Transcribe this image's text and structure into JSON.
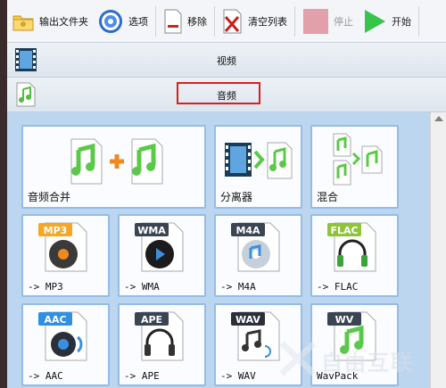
{
  "toolbar": {
    "output_folder_label": "输出文件夹",
    "options_label": "选项",
    "remove_label": "移除",
    "clear_list_label": "清空列表",
    "stop_label": "停止",
    "start_label": "开始"
  },
  "sections": {
    "video_label": "视频",
    "audio_label": "音频"
  },
  "tiles": [
    {
      "label": "音频合并",
      "icon": "audio-merge-icon"
    },
    {
      "label": "分离器",
      "icon": "splitter-icon"
    },
    {
      "label": "混合",
      "icon": "mix-icon"
    },
    {
      "label": "-> MP3",
      "badge": "MP3",
      "badge_color": "#f5a623",
      "icon": "mp3-disc-icon"
    },
    {
      "label": "-> WMA",
      "badge": "WMA",
      "badge_color": "#3a4452",
      "icon": "wma-disc-icon"
    },
    {
      "label": "-> M4A",
      "badge": "M4A",
      "badge_color": "#3a4452",
      "icon": "m4a-disc-icon"
    },
    {
      "label": "-> FLAC",
      "badge": "FLAC",
      "badge_color": "#8fc33a",
      "icon": "flac-headphones-icon"
    },
    {
      "label": "-> AAC",
      "badge": "AAC",
      "badge_color": "#2f8fe0",
      "icon": "aac-speaker-icon"
    },
    {
      "label": "-> APE",
      "badge": "APE",
      "badge_color": "#3a4452",
      "icon": "ape-headphones-icon"
    },
    {
      "label": "-> WAV",
      "badge": "WAV",
      "badge_color": "#2a2f3a",
      "icon": "wav-notes-icon"
    },
    {
      "label": "WavPack",
      "badge": "WV",
      "badge_color": "#3a4452",
      "icon": "wv-note-icon"
    }
  ],
  "watermark": {
    "text": "自由互联"
  },
  "colors": {
    "panel_bg": "#bcd6ef",
    "tile_border": "#94bce6",
    "highlight": "#d62020",
    "note_green": "#5cc84a"
  }
}
